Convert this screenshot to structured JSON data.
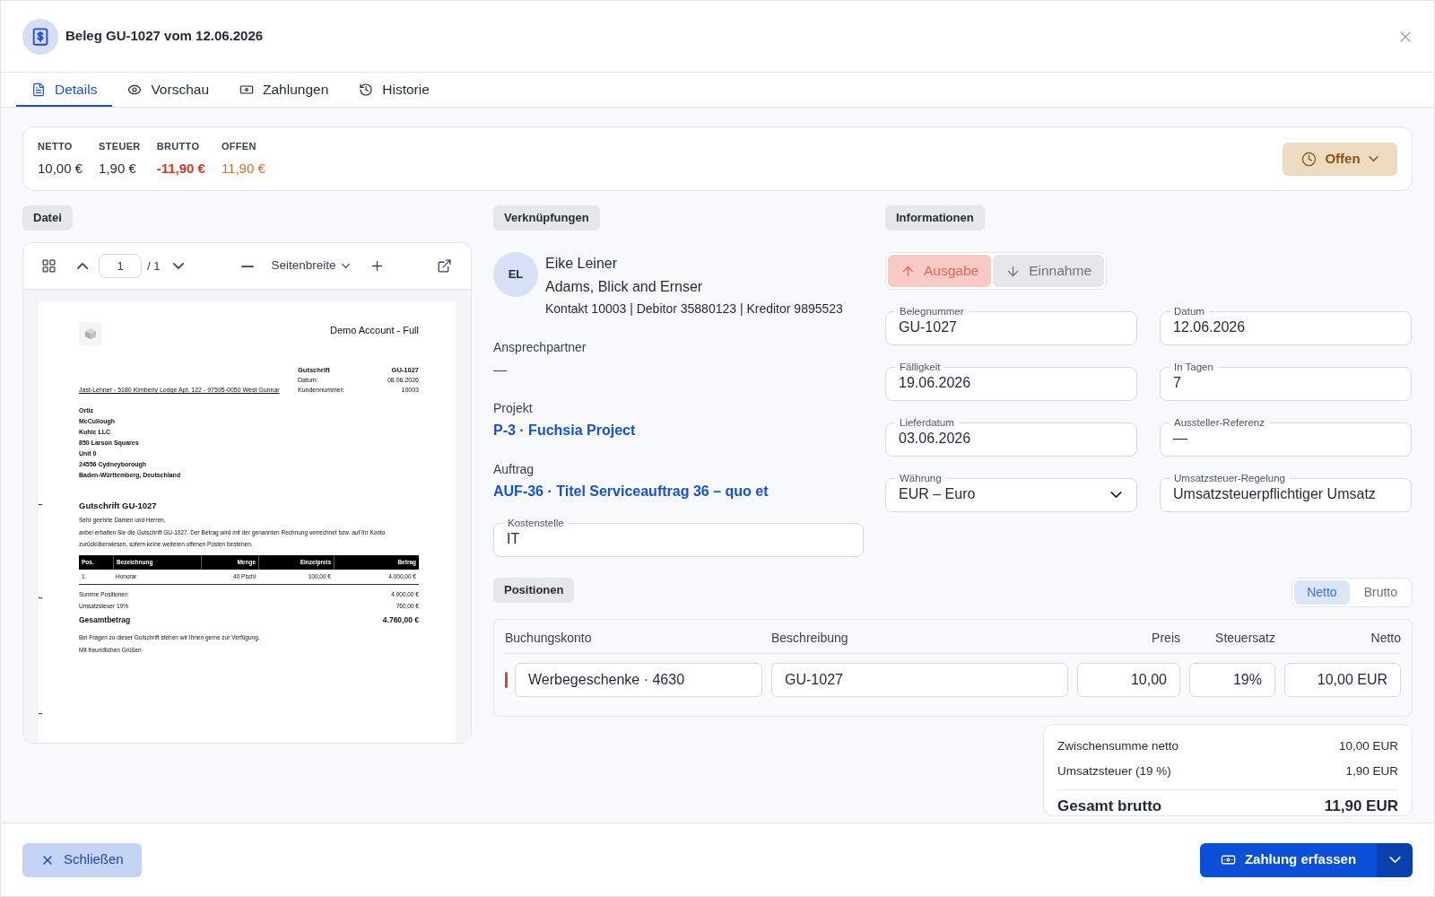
{
  "dialog": {
    "title": "Beleg GU-1027 vom 12.06.2026"
  },
  "tabs": [
    {
      "label": "Details",
      "selected": true
    },
    {
      "label": "Vorschau",
      "selected": false
    },
    {
      "label": "Zahlungen",
      "selected": false
    },
    {
      "label": "Historie",
      "selected": false
    }
  ],
  "totals": [
    {
      "label": "NETTO",
      "value": "10,00 €",
      "kind": "plain"
    },
    {
      "label": "STEUER",
      "value": "1,90 €",
      "kind": "plain"
    },
    {
      "label": "BRUTTO",
      "value": "-11,90 €",
      "kind": "negative"
    },
    {
      "label": "OFFEN",
      "value": "11,90 €",
      "kind": "open"
    }
  ],
  "status_button": {
    "label": "Offen"
  },
  "file": {
    "heading": "Datei",
    "viewer": {
      "page": "1",
      "page_count": "/ 1",
      "zoom": "Seitenbreite"
    },
    "document": {
      "company": "Demo Account - Full",
      "doc_type": "Gutschrift",
      "doc_number": "GU-1027",
      "meta": [
        {
          "label": "Datum:",
          "value": "08.06.2026"
        },
        {
          "label": "Kundennummer:",
          "value": "10003"
        }
      ],
      "sender_line": "Jast-Lehner - 5180 Kimberly Lodge Apt. 122 - 97595-0050 West Gunnar",
      "recipient": [
        "Ortiz",
        "McCullough",
        "Kuhic LLC",
        "850 Larson Squares",
        "Unit 0",
        "24556 Cydneyborough",
        "Baden-Württemberg, Deutschland"
      ],
      "heading": "Gutschrift GU-1027",
      "greeting": "Sehr geehrte Damen und Herren,",
      "body": "anbei erhalten Sie die Gutschrift GU-1027. Der Betrag wird mit der genannten Rechnung verrechnet bzw. auf Ihr Konto zurücküberwiesen, sofern keine weiteren offenen Posten bestehen.",
      "table": {
        "columns": [
          "Pos.",
          "Bezeichnung",
          "Menge",
          "Einzelpreis",
          "Betrag"
        ],
        "rows": [
          [
            "1.",
            "Honorar",
            "40 Pschl",
            "100,00 €",
            "4.000,00 €"
          ]
        ]
      },
      "totals": [
        {
          "label": "Summe Positionen",
          "value": "4.000,00 €",
          "kind": "line"
        },
        {
          "label": "Umsatzsteuer 19%",
          "value": "760,00 €",
          "kind": "line"
        },
        {
          "label": "Gesamtbetrag",
          "value": "4.760,00 €",
          "kind": "grand"
        }
      ],
      "closing": [
        "Bei Fragen zu dieser Gutschrift stehen wir Ihnen gerne zur Verfügung.",
        "Mit freundlichen Grüßen"
      ]
    }
  },
  "links": {
    "heading": "Verknüpfungen",
    "contact": {
      "initials": "EL",
      "name": "Eike Leiner",
      "company": "Adams, Blick and Ernser",
      "ids": "Kontakt 10003 | Debitor 35880123 | Kreditor 9895523"
    },
    "contact_person": {
      "label": "Ansprechpartner",
      "value": "—"
    },
    "project": {
      "label": "Projekt",
      "link": "P-3 · Fuchsia Project"
    },
    "order": {
      "label": "Auftrag",
      "link": "AUF-36 · Titel Serviceauftrag 36 – quo et"
    },
    "cost_center": {
      "label": "Kostenstelle",
      "value": "IT"
    }
  },
  "info": {
    "heading": "Informationen",
    "direction": [
      {
        "label": "Ausgabe",
        "selected": true
      },
      {
        "label": "Einnahme",
        "selected": false
      }
    ],
    "fields": [
      {
        "label": "Belegnummer",
        "value": "GU-1027",
        "kind": "text"
      },
      {
        "label": "Datum",
        "value": "12.06.2026",
        "kind": "text"
      },
      {
        "label": "Fälligkeit",
        "value": "19.06.2026",
        "kind": "text"
      },
      {
        "label": "In Tagen",
        "value": "7",
        "kind": "text"
      },
      {
        "label": "Lieferdatum",
        "value": "03.06.2026",
        "kind": "text"
      },
      {
        "label": "Aussteller-Referenz",
        "value": "—",
        "kind": "text"
      },
      {
        "label": "Währung",
        "value": "EUR – Euro",
        "kind": "select"
      },
      {
        "label": "Umsatzsteuer-Regelung",
        "value": "Umsatzsteuerpflichtiger Umsatz",
        "kind": "text"
      }
    ]
  },
  "positions": {
    "heading": "Positionen",
    "mode": [
      {
        "label": "Netto",
        "selected": true
      },
      {
        "label": "Brutto",
        "selected": false
      }
    ],
    "columns": [
      "Buchungskonto",
      "Beschreibung",
      "Preis",
      "Steuersatz",
      "Netto"
    ],
    "rows": [
      {
        "account": "Werbegeschenke · 4630",
        "description": "GU-1027",
        "price": "10,00",
        "tax": "19%",
        "net": "10,00 EUR",
        "color": "#d9472b"
      }
    ],
    "summary": [
      {
        "label": "Zwischensumme netto",
        "value": "10,00 EUR",
        "kind": "line"
      },
      {
        "label": "Umsatzsteuer (19 %)",
        "value": "1,90 EUR",
        "kind": "line"
      },
      {
        "label": "Gesamt brutto",
        "value": "11,90 EUR",
        "kind": "total"
      }
    ]
  },
  "footer": {
    "close": "Schließen",
    "primary": "Zahlung erfassen"
  }
}
